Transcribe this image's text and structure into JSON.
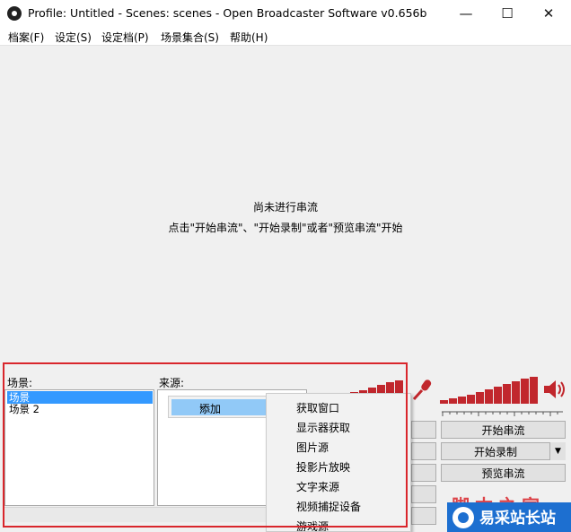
{
  "window": {
    "title": "Profile: Untitled - Scenes: scenes - Open Broadcaster Software v0.656b",
    "minimize_glyph": "—",
    "maximize_glyph": "☐",
    "close_glyph": "✕"
  },
  "menubar": {
    "items": [
      "档案(F)",
      "设定(S)",
      "设定档(P)",
      "场景集合(S)",
      "帮助(H)"
    ]
  },
  "preview": {
    "line1": "尚未进行串流",
    "line2": "点击\"开始串流\"、\"开始录制\"或者\"预览串流\"开始"
  },
  "scenes": {
    "label": "场景:",
    "items": [
      "场景",
      "场景 2"
    ]
  },
  "sources": {
    "label": "来源:"
  },
  "context_menu": {
    "add_label": "添加",
    "arrow_glyph": "›"
  },
  "add_submenu": {
    "items": [
      "获取窗口",
      "显示器获取",
      "图片源",
      "投影片放映",
      "文字来源",
      "视频捕捉设备",
      "游戏源"
    ]
  },
  "controls": {
    "start_stream": "开始串流",
    "start_record": "开始录制",
    "preview_stream": "预览串流",
    "dropdown_glyph": "▼"
  },
  "watermark": {
    "text": "脚本之家",
    "badge_text": "易采站长站"
  },
  "colors": {
    "accent_red": "#c1272d",
    "selection_blue": "#3399ff",
    "menu_hover_blue": "#91c9f7",
    "badge_blue": "#1d6fd0"
  }
}
